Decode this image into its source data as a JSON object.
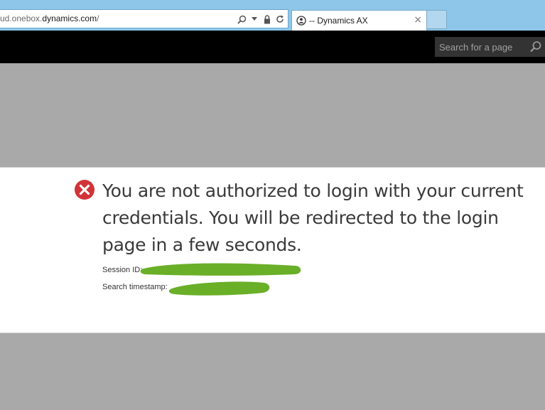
{
  "browser": {
    "address_prefix": "ud.onebox.",
    "address_domain": "dynamics.com",
    "address_suffix": "/",
    "tab_title": "-- Dynamics AX",
    "tab_close_glyph": "×",
    "icons": [
      "search-icon",
      "dropdown-arrow-icon",
      "lock-icon",
      "refresh-icon",
      "favicon",
      "close-icon"
    ]
  },
  "header": {
    "search_placeholder": "Search for a page",
    "search_icon": "search-icon"
  },
  "message": {
    "icon": "error-icon",
    "text": "You are not authorized to login with your current credentials. You will be redirected to the login page in a few seconds.",
    "session_label": "Session ID:",
    "timestamp_label": "Search timestamp:"
  },
  "colors": {
    "error_red": "#d13438",
    "redaction_green": "#6aaf28",
    "header_black": "#000000",
    "page_gray": "#a9a9a9"
  }
}
